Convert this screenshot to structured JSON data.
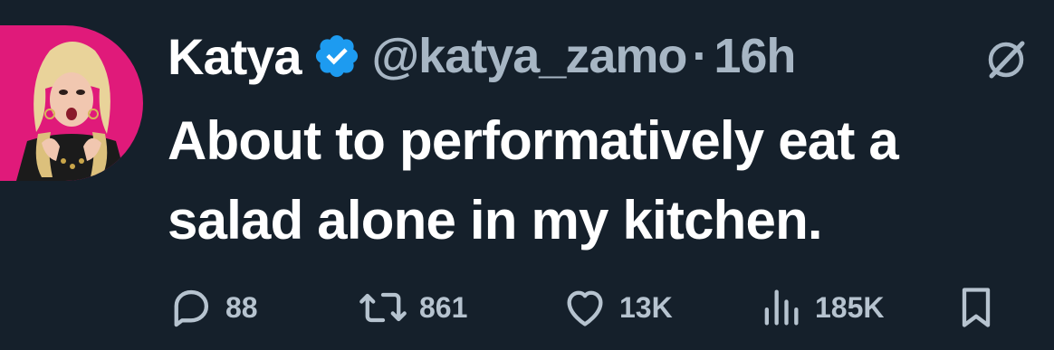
{
  "tweet": {
    "display_name": "Katya",
    "handle": "@katya_zamo",
    "separator": "·",
    "time": "16h",
    "text_line1": "About to performatively eat a",
    "text_line2": "salad alone in my kitchen.",
    "verified": true
  },
  "actions": {
    "replies": "88",
    "retweets": "861",
    "likes": "13K",
    "views": "185K"
  },
  "icons": {
    "verified": "verified-badge-icon",
    "grok": "grok-icon",
    "reply": "reply-icon",
    "retweet": "retweet-icon",
    "like": "heart-icon",
    "views": "views-chart-icon",
    "bookmark": "bookmark-icon"
  },
  "colors": {
    "background": "#15202b",
    "text": "#ffffff",
    "muted": "#a7b6c4",
    "verified_blue": "#1d9bf0",
    "avatar_bg": "#e01a7a"
  }
}
